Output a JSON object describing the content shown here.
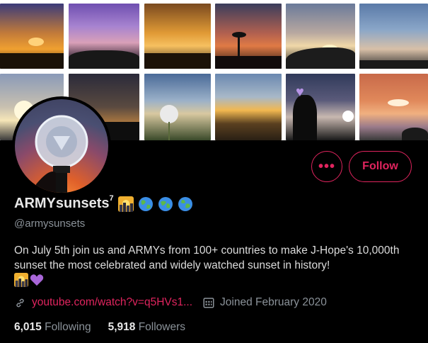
{
  "colors": {
    "accent": "#e0245e",
    "background": "#000000",
    "muted": "#8b9299"
  },
  "banner": {
    "description": "sunset photo collage"
  },
  "profile": {
    "name": "ARMYsunsets",
    "name_suffix": "7",
    "name_emojis": [
      "sunrise-over-city-emoji",
      "globe-emoji",
      "globe-emoji",
      "globe-emoji"
    ],
    "handle": "@armysunsets",
    "bio": "On July 5th join us and ARMYs from 100+ countries to make J-Hope's 10,000th sunset the most celebrated and widely watched sunset in history!",
    "bio_emojis": [
      "sunrise-over-city-emoji",
      "purple-heart-emoji"
    ],
    "link": "youtube.com/watch?v=q5HVs1...",
    "joined": "Joined February 2020",
    "following_count": "6,015",
    "following_label": "Following",
    "followers_count": "5,918",
    "followers_label": "Followers"
  },
  "actions": {
    "more_label": "•••",
    "follow_label": "Follow"
  }
}
